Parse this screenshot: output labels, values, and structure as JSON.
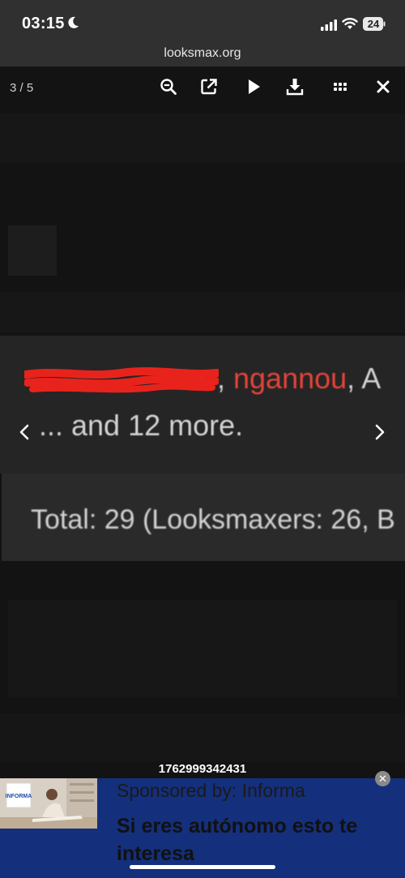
{
  "status": {
    "time": "03:15",
    "battery": "24"
  },
  "browser": {
    "url": "looksmax.org"
  },
  "viewer": {
    "counter": "3 / 5",
    "toolbar": [
      "zoom-out-icon",
      "open-external-icon",
      "play-icon",
      "download-icon",
      "grid-icon",
      "close-icon"
    ]
  },
  "image": {
    "name_sep1": ", ",
    "name_red": "ngannou",
    "name_sep2": ", A",
    "more_text": "... and 12 more.",
    "total_text": "Total: 29 (Looksmaxers: 26, B"
  },
  "footer": {
    "id": "1762999342431"
  },
  "ad": {
    "sponsor": "Sponsored by: Informa",
    "headline": "Si eres autónomo esto te interesa",
    "logo": "INFORMA"
  }
}
